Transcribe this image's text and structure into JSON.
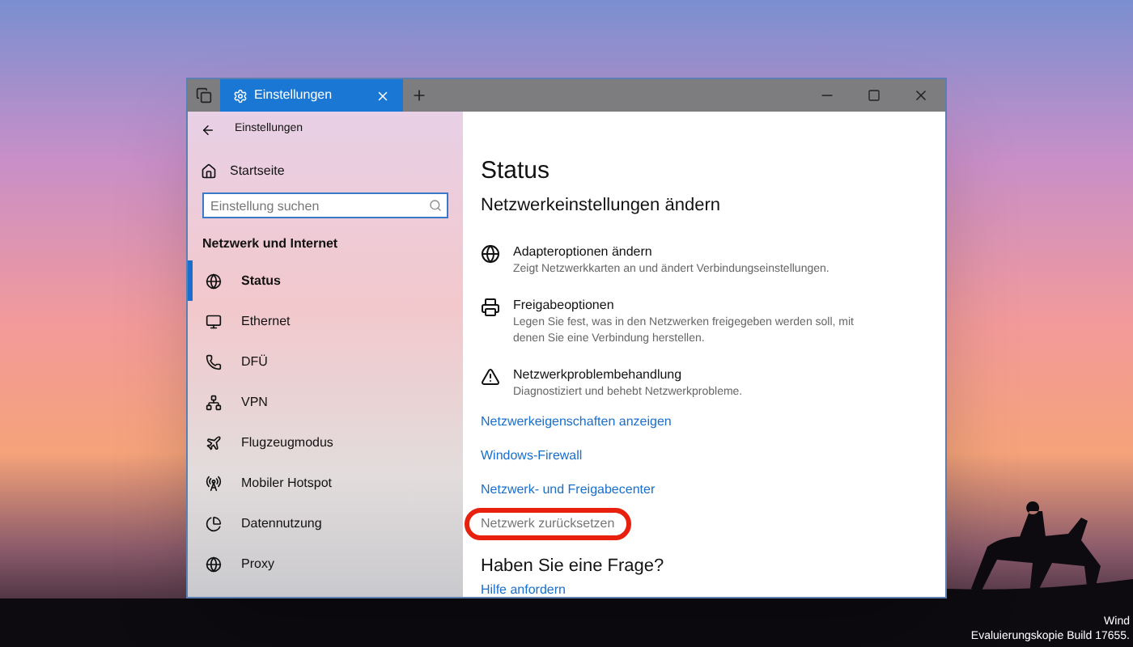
{
  "window": {
    "tab_title": "Einstellungen",
    "back_label": "Einstellungen"
  },
  "sidebar": {
    "home": "Startseite",
    "search": {
      "placeholder": "Einstellung suchen"
    },
    "section": "Netzwerk und Internet",
    "items": [
      {
        "label": "Status",
        "selected": true
      },
      {
        "label": "Ethernet",
        "selected": false
      },
      {
        "label": "DFÜ",
        "selected": false
      },
      {
        "label": "VPN",
        "selected": false
      },
      {
        "label": "Flugzeugmodus",
        "selected": false
      },
      {
        "label": "Mobiler Hotspot",
        "selected": false
      },
      {
        "label": "Datennutzung",
        "selected": false
      },
      {
        "label": "Proxy",
        "selected": false
      }
    ]
  },
  "content": {
    "title": "Status",
    "subtitle": "Netzwerkeinstellungen ändern",
    "options": [
      {
        "title": "Adapteroptionen ändern",
        "description": "Zeigt Netzwerkkarten an und ändert Verbindungseinstellungen."
      },
      {
        "title": "Freigabeoptionen",
        "description": "Legen Sie fest, was in den Netzwerken freigegeben werden soll, mit denen Sie eine Verbindung herstellen."
      },
      {
        "title": "Netzwerkproblembehandlung",
        "description": "Diagnostiziert und behebt Netzwerkprobleme."
      }
    ],
    "links": [
      {
        "label": "Netzwerkeigenschaften anzeigen",
        "disabled": false,
        "circled": false
      },
      {
        "label": "Windows-Firewall",
        "disabled": false,
        "circled": false
      },
      {
        "label": "Netzwerk- und Freigabecenter",
        "disabled": false,
        "circled": false
      },
      {
        "label": "Netzwerk zurücksetzen",
        "disabled": true,
        "circled": true
      }
    ],
    "question": "Haben Sie eine Frage?",
    "help_link": "Hilfe anfordern"
  },
  "desktop": {
    "watermark_lines": [
      "Wind",
      "Evaluierungskopie Build 17655."
    ]
  }
}
